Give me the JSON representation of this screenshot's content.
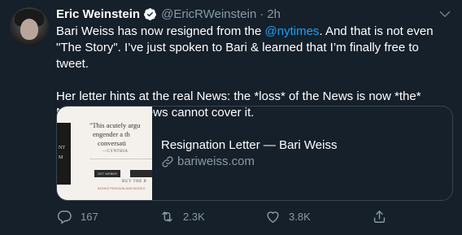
{
  "author": {
    "name": "Eric Weinstein",
    "handle": "@EricRWeinstein",
    "separator": "·",
    "time": "2h"
  },
  "tweet": {
    "line1_before": "Bari Weiss has now resigned from the ",
    "mention": "@nytimes",
    "line1_after": ". And that is not even \"The Story\". I’ve just spoken to Bari & learned that I’m finally free to tweet.",
    "paragraph2": "Her letter hints at the real News: the *loss* of the News is now *the* News, and the News cannot cover it."
  },
  "card": {
    "title": "Resignation Letter — Bari Weiss",
    "domain": "bariweiss.com",
    "thumb": {
      "quote_line1": "\"This acutely argu",
      "quote_line2": "engender a th",
      "quote_line3": "conversati",
      "author": "—CYNTHIA",
      "button": "GET WEBER",
      "buy": "BUY THE B",
      "fine": "BOOKS PENGUIN AND BOOKS",
      "dark_text1": "NT",
      "dark_text2": "M"
    }
  },
  "actions": {
    "replies": "167",
    "retweets": "2.3K",
    "likes": "3.8K"
  },
  "colors": {
    "background": "#15202b",
    "accent": "#1da1f2",
    "muted": "#8899a6",
    "border": "#38444d"
  }
}
